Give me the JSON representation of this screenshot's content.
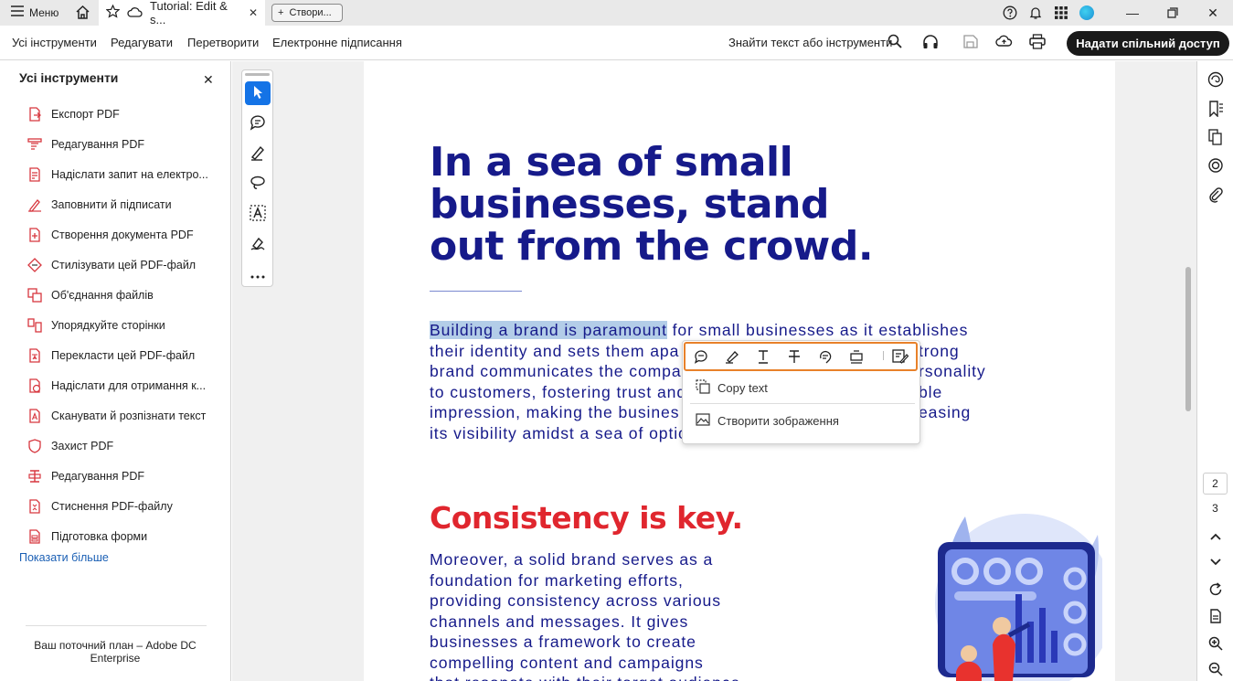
{
  "titlebar": {
    "menu_label": "Меню",
    "tab_title": "Tutorial: Edit & s...",
    "new_tab_label": "Створи..."
  },
  "menubar": {
    "items": [
      "Усі інструменти",
      "Редагувати",
      "Перетворити",
      "Електронне підписання"
    ],
    "find_label": "Знайти текст або інструменти",
    "share_label": "Надати спільний доступ"
  },
  "left_panel": {
    "title": "Усі інструменти",
    "tools": [
      {
        "label": "Експорт PDF",
        "icon": "export-pdf-icon"
      },
      {
        "label": "Редагування PDF",
        "icon": "edit-pdf-icon"
      },
      {
        "label": "Надіслати запит на електро...",
        "icon": "request-esign-icon"
      },
      {
        "label": "Заповнити й підписати",
        "icon": "fill-sign-icon"
      },
      {
        "label": "Створення документа PDF",
        "icon": "create-pdf-icon"
      },
      {
        "label": "Стилізувати цей PDF-файл",
        "icon": "stylize-pdf-icon"
      },
      {
        "label": "Об'єднання файлів",
        "icon": "combine-files-icon"
      },
      {
        "label": "Упорядкуйте сторінки",
        "icon": "organize-pages-icon"
      },
      {
        "label": "Перекласти цей PDF-файл",
        "icon": "translate-pdf-icon"
      },
      {
        "label": "Надіслати для отримання к...",
        "icon": "send-for-comments-icon"
      },
      {
        "label": "Сканувати й розпізнати текст",
        "icon": "scan-ocr-icon"
      },
      {
        "label": "Захист PDF",
        "icon": "protect-pdf-icon"
      },
      {
        "label": "Редагування PDF",
        "icon": "redact-pdf-icon"
      },
      {
        "label": "Стиснення PDF-файлу",
        "icon": "compress-pdf-icon"
      },
      {
        "label": "Підготовка форми",
        "icon": "prepare-form-icon"
      }
    ],
    "show_more": "Показати більше",
    "plan_text": "Ваш поточний план – Adobe DC Enterprise"
  },
  "document": {
    "heading1": "In a sea of small\nbusinesses, stand\nout from the crowd.",
    "para1_highlight": "Building a brand is paramount",
    "para1_line1_rest": " for small businesses as it establishes",
    "para1_lines": [
      "their identity and sets them apa",
      "brand communicates the compa",
      "to customers, fostering trust and",
      "impression, making the busines",
      "its visibility amidst a sea of optio"
    ],
    "para1_right_fragments": [
      "trong",
      "rsonality",
      "ble",
      "easing"
    ],
    "heading2": "Consistency is key.",
    "para2_lines": [
      "Moreover, a solid brand serves as a",
      "foundation for marketing efforts,",
      "providing consistency across various",
      "channels and messages. It gives",
      "businesses a framework to create",
      "compelling content and campaigns",
      "that resonate with their target audience"
    ]
  },
  "context_menu": {
    "copy_text": "Copy text",
    "create_image": "Створити зображення"
  },
  "page_nav": {
    "current": "2",
    "next": "3"
  },
  "colors": {
    "heading_blue": "#161a8a",
    "heading_red": "#e0262e",
    "highlight": "#b3cde8",
    "popup_outline": "#e8812a",
    "select_blue": "#1473e6"
  }
}
